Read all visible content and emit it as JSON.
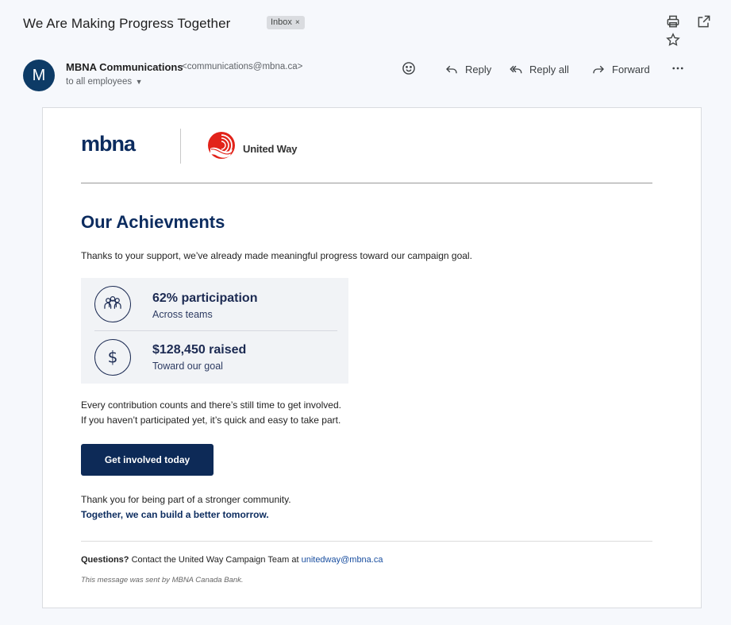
{
  "email": {
    "subject": "We Are Making Progress Together",
    "label_chip": "Inbox",
    "label_chip_close": "×",
    "sender": {
      "avatar_letter": "M",
      "name": "MBNA Communications",
      "email": "<communications@mbna.ca>",
      "recipients": "to all employees"
    },
    "actions": {
      "reply": "Reply",
      "reply_all": "Reply all",
      "forward": "Forward"
    },
    "icons": [
      "print-icon",
      "open-in-new-window-icon",
      "star-icon",
      "emoji-icon",
      "reply-icon",
      "reply-all-icon",
      "forward-icon",
      "more-vertical-icon"
    ]
  },
  "content": {
    "logo_mbna": "mbna",
    "logo_united_way": "United Way",
    "heading": "Our Achievments",
    "intro": "Thanks to your support, we’ve already made meaningful progress toward our campaign goal.",
    "stats": [
      {
        "icon": "people-icon",
        "title": "62% participation",
        "subtitle": "Across teams"
      },
      {
        "icon": "dollar-icon",
        "title": "$128,450 raised",
        "subtitle": "Toward our goal"
      }
    ],
    "body_line_1": "Every contribution counts and there’s still time to get involved.",
    "body_line_2": "If you haven’t participated yet, it’s quick and easy to take part.",
    "cta_label": "Get involved today",
    "thanks": "Thank you for being part of a stronger community.",
    "together": "Together, we can build a better tomorrow.",
    "questions_label": "Questions?",
    "questions_text": " Contact the United Way Campaign Team at ",
    "questions_email": "unitedway@mbna.ca",
    "sent_by": "This message was sent by MBNA Canada Bank."
  },
  "colors": {
    "brand_navy": "#0c2c5f",
    "united_way_red": "#e2231a",
    "page_bg": "#f6f8fc"
  }
}
